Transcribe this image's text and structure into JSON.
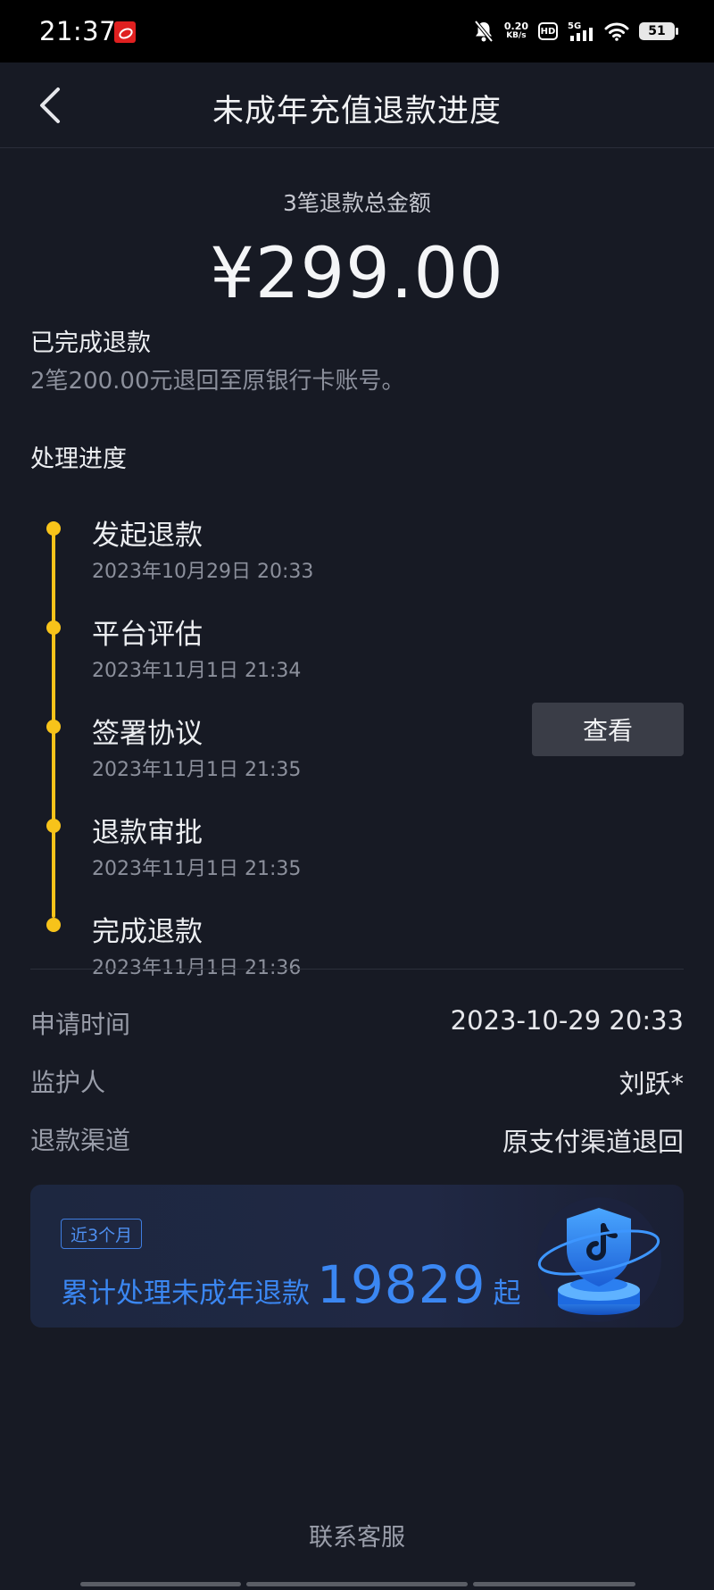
{
  "status_bar": {
    "time": "21:37",
    "net_speed_value": "0.20",
    "net_speed_unit": "KB/s",
    "hd_label": "HD",
    "signal_label": "5G",
    "battery": "51",
    "icons": [
      "app-notification-icon",
      "mute-icon",
      "hd-icon",
      "signal-icon",
      "wifi-icon",
      "battery-icon"
    ]
  },
  "nav": {
    "title": "未成年充值退款进度",
    "back_icon": "chevron-left-icon"
  },
  "summary": {
    "amount_label": "3笔退款总金额",
    "amount": "¥299.00",
    "done_title": "已完成退款",
    "done_desc": "2笔200.00元退回至原银行卡账号。"
  },
  "progress": {
    "title": "处理进度",
    "accent_color": "#f7c31a",
    "steps": [
      {
        "name": "发起退款",
        "time": "2023年10月29日 20:33"
      },
      {
        "name": "平台评估",
        "time": "2023年11月1日 21:34"
      },
      {
        "name": "签署协议",
        "time": "2023年11月1日 21:35"
      },
      {
        "name": "退款审批",
        "time": "2023年11月1日 21:35"
      },
      {
        "name": "完成退款",
        "time": "2023年11月1日 21:36"
      }
    ],
    "view_button": "查看"
  },
  "info": {
    "rows": [
      {
        "label": "申请时间",
        "value": "2023-10-29 20:33"
      },
      {
        "label": "监护人",
        "value": "刘跃*"
      },
      {
        "label": "退款渠道",
        "value": "原支付渠道退回"
      }
    ]
  },
  "banner": {
    "badge": "近3个月",
    "text_prefix": "累计处理未成年退款",
    "count": "19829",
    "text_suffix": "起",
    "accent_color": "#3b87f2",
    "icon": "tiktok-shield-icon"
  },
  "footer": {
    "contact": "联系客服"
  }
}
